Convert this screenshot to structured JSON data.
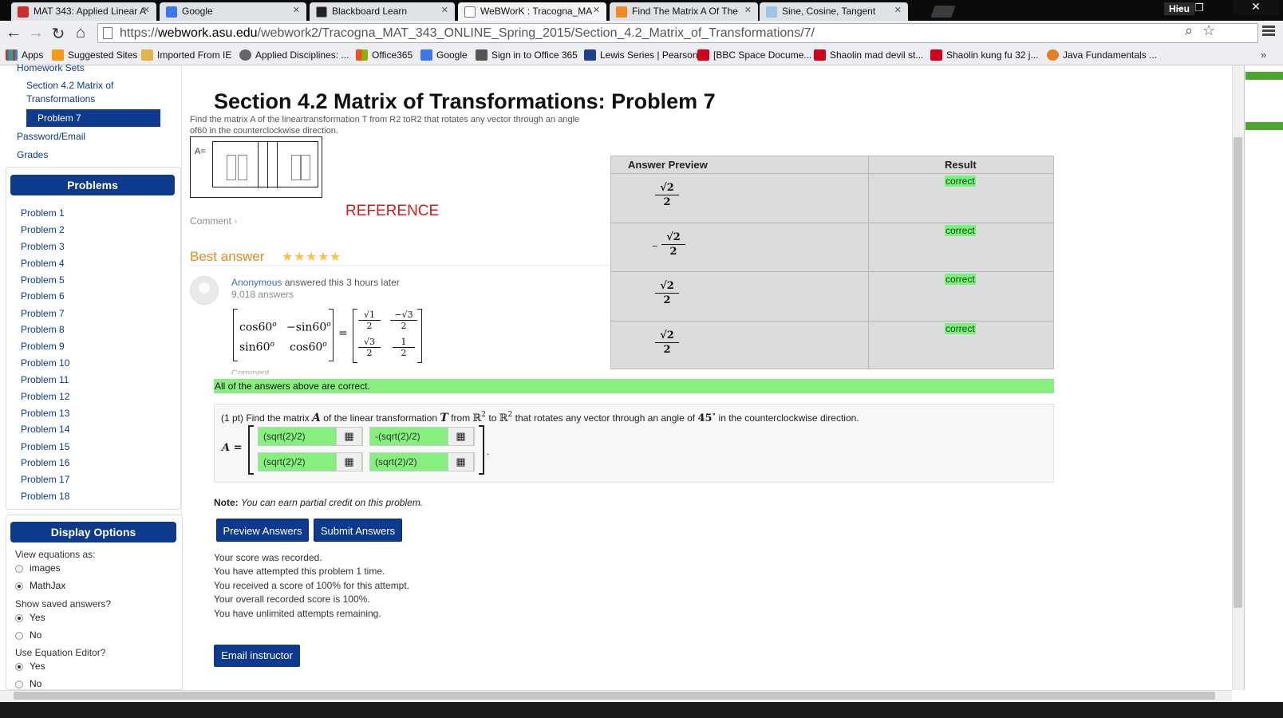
{
  "browser": {
    "tabs": [
      {
        "label": "MAT 343: Applied Linear A"
      },
      {
        "label": "Google"
      },
      {
        "label": "Blackboard Learn"
      },
      {
        "label": "WeBWorK : Tracogna_MA"
      },
      {
        "label": "Find The Matrix A Of The"
      },
      {
        "label": "Sine, Cosine, Tangent"
      }
    ],
    "user": "Hieu",
    "url_prefix": "https://",
    "url_host": "webwork.asu.edu",
    "url_path": "/webwork2/Tracogna_MAT_343_ONLINE_Spring_2015/Section_4.2_Matrix_of_Transformations/7/",
    "bookmarks": [
      "Apps",
      "Suggested Sites",
      "Imported From IE",
      "Applied Disciplines: ...",
      "Office365",
      "Google",
      "Sign in to Office 365",
      "Lewis Series | Pearson",
      "[BBC Space Docume...",
      "Shaolin mad devil st...",
      "Shaolin kung fu 32 j...",
      "Java Fundamentals ..."
    ]
  },
  "sidebar": {
    "homework_sets": "Homework Sets",
    "section_line1": "Section 4.2 Matrix of",
    "section_line2": "Transformations",
    "active_problem": "Problem 7",
    "password_email": "Password/Email",
    "grades": "Grades",
    "problems_heading": "Problems",
    "problems": [
      "Problem 1",
      "Problem 2",
      "Problem 3",
      "Problem 4",
      "Problem 5",
      "Problem 6",
      "Problem 7",
      "Problem 8",
      "Problem 9",
      "Problem 10",
      "Problem 11",
      "Problem 12",
      "Problem 13",
      "Problem 14",
      "Problem 15",
      "Problem 16",
      "Problem 17",
      "Problem 18"
    ],
    "display_options_heading": "Display Options",
    "view_equations_label": "View equations as:",
    "opt_images": "images",
    "opt_mathjax": "MathJax",
    "show_saved_label": "Show saved answers?",
    "yes": "Yes",
    "no": "No",
    "use_editor_label": "Use Equation Editor?"
  },
  "page": {
    "title": "Section 4.2 Matrix of Transformations: Problem 7"
  },
  "overlay": {
    "question_line1": "Find the matrix A of the lineartransformation T from R2 toR2 that rotates any vector through an angle",
    "question_line2": "of60 in the counterclockwise direction.",
    "a_label": "A=",
    "reference": "REFERENCE",
    "comment": "Comment",
    "best_answer": "Best answer",
    "answerer": "Anonymous",
    "answered_suffix": "answered this 3 hours later",
    "answer_count": "9,018 answers",
    "matrix": {
      "cos": "cos60",
      "neg_sin": "−sin60",
      "sin": "sin60",
      "cos2": "cos60",
      "deg": "o",
      "eq": "=",
      "f1_num": "√1",
      "f2_num": "−√3",
      "f3_num": "√3",
      "f4_num": "1",
      "den": "2"
    },
    "comment_partial": "Comment"
  },
  "preview_table": {
    "header_preview": "Answer Preview",
    "header_result": "Result",
    "rows": [
      {
        "num": "√2",
        "den": "2",
        "negative": false,
        "result": "correct"
      },
      {
        "num": "√2",
        "den": "2",
        "negative": true,
        "result": "correct"
      },
      {
        "num": "√2",
        "den": "2",
        "negative": false,
        "result": "correct"
      },
      {
        "num": "√2",
        "den": "2",
        "negative": false,
        "result": "correct"
      }
    ],
    "minus": "−"
  },
  "all_correct": "All of the answers above are correct.",
  "problem": {
    "points": "(1 pt) Find the matrix",
    "var_A": "A",
    "of_linear": "of the linear transformation",
    "var_T": "T",
    "from": "from",
    "R": "ℝ",
    "exp": "2",
    "to": "to",
    "rotates": "that rotates any vector through an angle of",
    "angle": "45",
    "deg": "∘",
    "direction": "in the counterclockwise direction.",
    "a_eq": "A =",
    "period": ".",
    "inputs": [
      "(sqrt(2)/2)",
      "-(sqrt(2)/2)",
      "(sqrt(2)/2)",
      "(sqrt(2)/2)"
    ],
    "editor_icon": "▦"
  },
  "note_label": "Note:",
  "note_text": "You can earn partial credit on this problem.",
  "buttons": {
    "preview": "Preview Answers",
    "submit": "Submit Answers",
    "email": "Email instructor"
  },
  "status_lines": [
    "Your score was recorded.",
    "You have attempted this problem 1 time.",
    "You received a score of 100% for this attempt.",
    "Your overall recorded score is 100%.",
    "You have unlimited attempts remaining."
  ],
  "colors": {
    "brand": "#0d3a8c",
    "correct_green": "#86ef7f",
    "reference_red": "#d01c1c",
    "best_answer_orange": "#e88b1a"
  }
}
